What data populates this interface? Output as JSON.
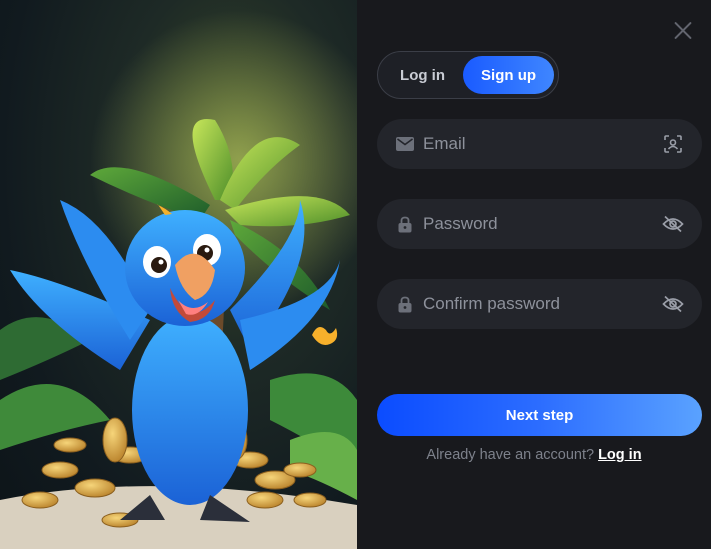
{
  "auth_switch": {
    "login_label": "Log in",
    "signup_label": "Sign up",
    "active": "signup"
  },
  "form": {
    "email": {
      "placeholder": "Email",
      "value": "",
      "lead_icon": "mail-icon",
      "trail_icon": "contact-card-icon"
    },
    "password": {
      "placeholder": "Password",
      "value": "",
      "lead_icon": "lock-icon",
      "trail_icon": "eye-off-icon"
    },
    "confirm_password": {
      "placeholder": "Confirm password",
      "value": "",
      "lead_icon": "lock-icon",
      "trail_icon": "eye-off-icon"
    }
  },
  "next_button": {
    "label": "Next step"
  },
  "footer": {
    "prompt": "Already have an account?",
    "link_label": "Log in"
  },
  "colors": {
    "accent": "#1a5bff",
    "panel_bg": "#18191d",
    "field_bg": "#23252b"
  }
}
